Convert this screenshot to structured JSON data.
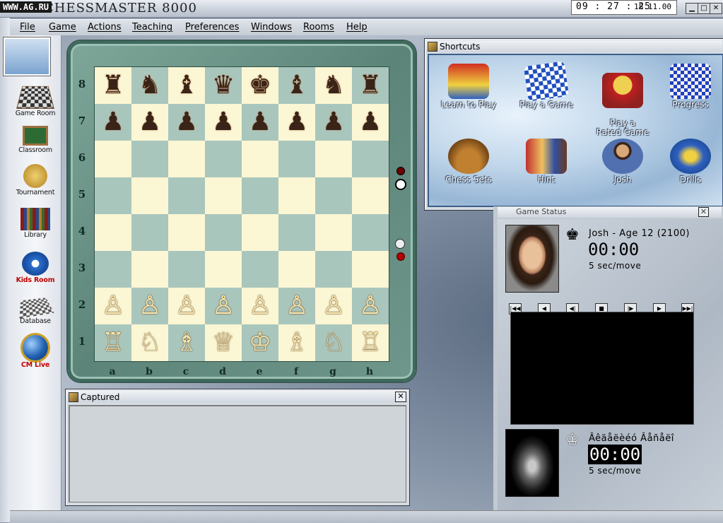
{
  "watermark": "WWW.AG.RU",
  "app_title": "CHESSMASTER 8000",
  "clock": {
    "time": "09 : 27 : 25",
    "date": "18.11.00"
  },
  "menu": [
    "File",
    "Game",
    "Actions",
    "Teaching",
    "Preferences",
    "Windows",
    "Rooms",
    "Help"
  ],
  "toolbar": [
    {
      "label": "Game Room",
      "icon": "game-room-icon"
    },
    {
      "label": "Classroom",
      "icon": "classroom-icon"
    },
    {
      "label": "Tournament",
      "icon": "tournament-icon"
    },
    {
      "label": "Library",
      "icon": "library-icon"
    },
    {
      "label": "Kids Room",
      "icon": "kids-room-icon"
    },
    {
      "label": "Database",
      "icon": "database-icon"
    },
    {
      "label": "CM Live",
      "icon": "cm-live-icon"
    }
  ],
  "board": {
    "ranks": [
      "8",
      "7",
      "6",
      "5",
      "4",
      "3",
      "2",
      "1"
    ],
    "files": [
      "a",
      "b",
      "c",
      "d",
      "e",
      "f",
      "g",
      "h"
    ],
    "position": [
      [
        "r",
        "n",
        "b",
        "q",
        "k",
        "b",
        "n",
        "r"
      ],
      [
        "p",
        "p",
        "p",
        "p",
        "p",
        "p",
        "p",
        "p"
      ],
      [
        "",
        "",
        "",
        "",
        "",
        "",
        "",
        ""
      ],
      [
        "",
        "",
        "",
        "",
        "",
        "",
        "",
        ""
      ],
      [
        "",
        "",
        "",
        "",
        "",
        "",
        "",
        ""
      ],
      [
        "",
        "",
        "",
        "",
        "",
        "",
        "",
        ""
      ],
      [
        "P",
        "P",
        "P",
        "P",
        "P",
        "P",
        "P",
        "P"
      ],
      [
        "R",
        "N",
        "B",
        "Q",
        "K",
        "B",
        "N",
        "R"
      ]
    ]
  },
  "shortcuts": {
    "title": "Shortcuts",
    "items": [
      {
        "label": "Learn to Play",
        "icon": "learn-to-play-icon"
      },
      {
        "label": "Play a Game",
        "icon": "play-game-icon"
      },
      {
        "label": "Play a\nRated Game",
        "icon": "rated-game-icon"
      },
      {
        "label": "Progress",
        "icon": "progress-icon"
      },
      {
        "label": "Chess Sets",
        "icon": "chess-sets-icon"
      },
      {
        "label": "Hint",
        "icon": "hint-icon"
      },
      {
        "label": "Josh",
        "icon": "josh-icon"
      },
      {
        "label": "Drills",
        "icon": "drills-icon"
      }
    ]
  },
  "captured": {
    "title": "Captured"
  },
  "status": {
    "title": "Game Status",
    "black": {
      "name": "Josh - Age 12 (2100)",
      "time": "00:00",
      "rate": "5  sec/move"
    },
    "white": {
      "name": "Âêäåëèéó Âåñåëî",
      "time": "00:00",
      "rate": "5  sec/move"
    },
    "controls": [
      "|◀◀",
      "◀",
      "◀|",
      "■",
      "|▶",
      "▶",
      "▶▶|"
    ]
  }
}
